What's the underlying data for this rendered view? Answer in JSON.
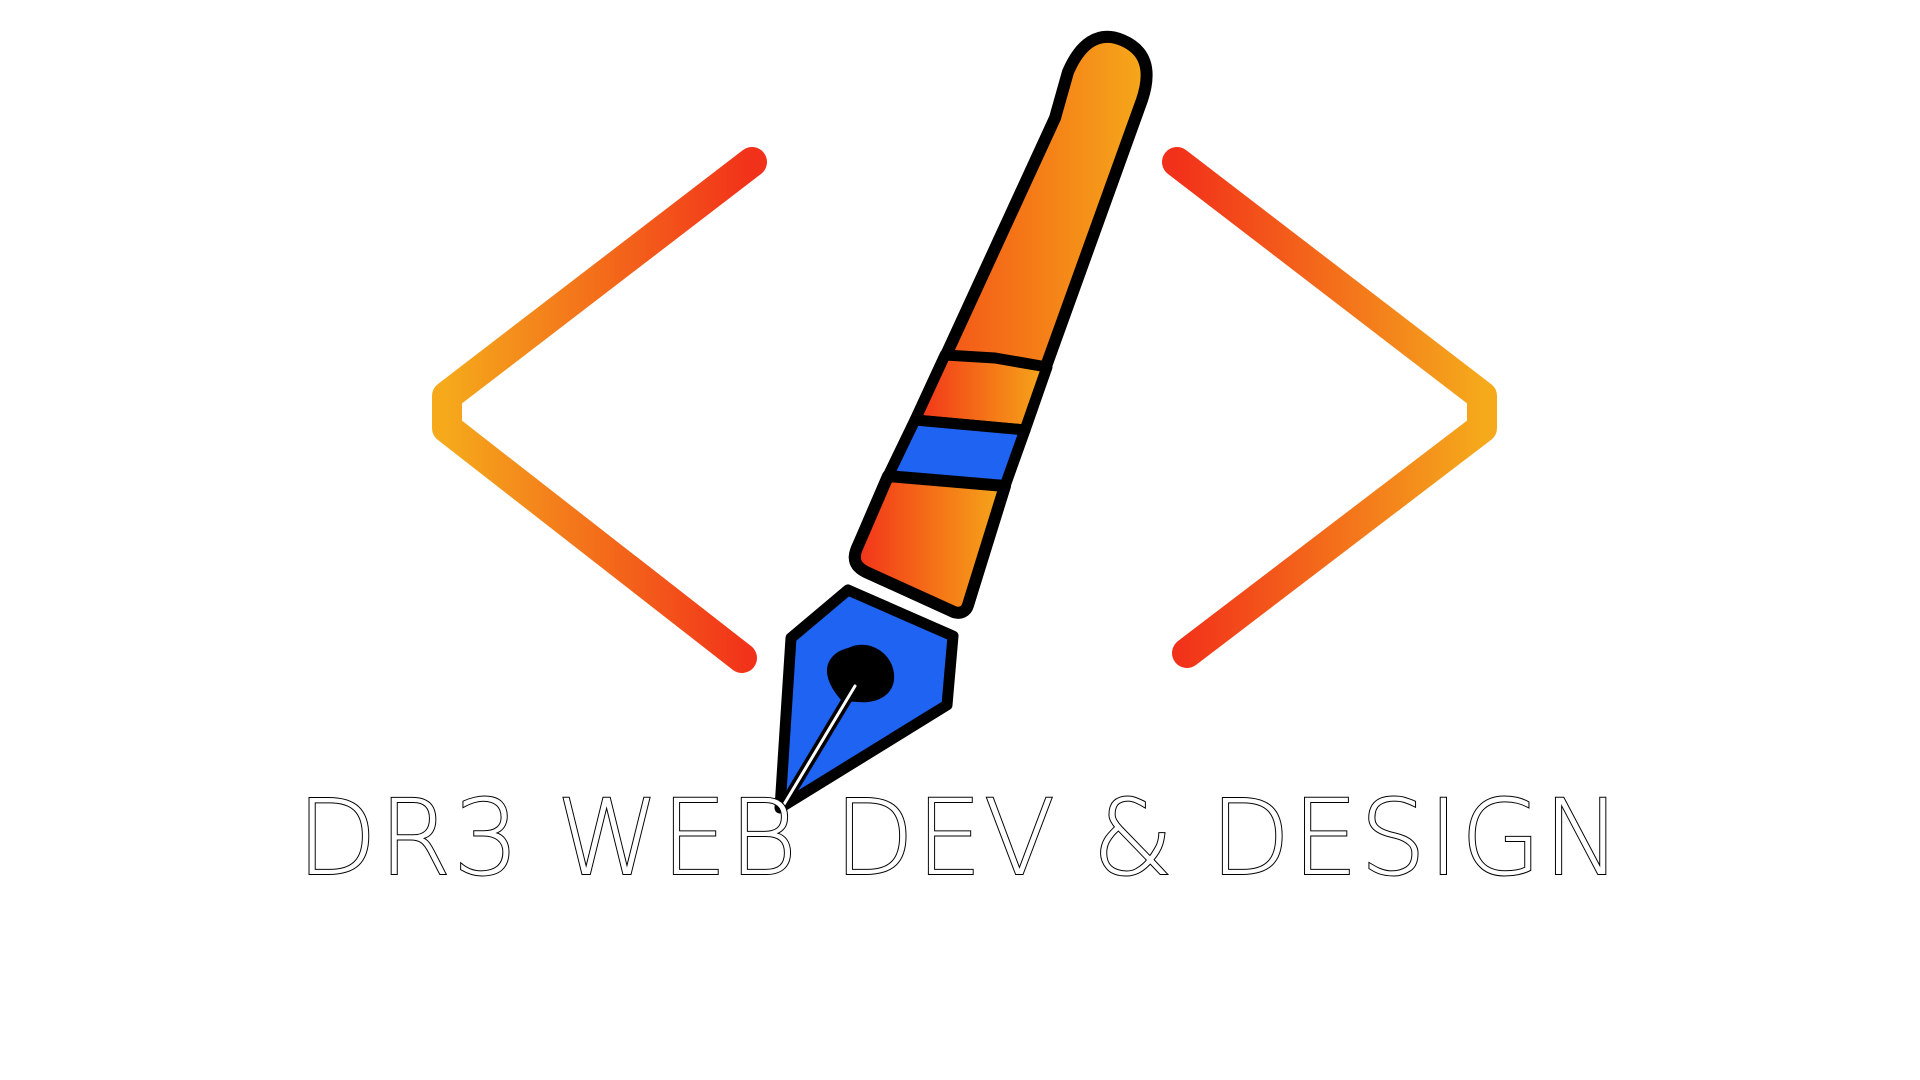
{
  "brand": {
    "name": "DR3 WEB DEV & DESIGN"
  },
  "logo": {
    "icons": [
      "left-angle-bracket-icon",
      "fountain-pen-icon",
      "right-angle-bracket-icon"
    ],
    "colors": {
      "gradient_red": "#f2311a",
      "gradient_orange": "#f57a17",
      "gradient_yellow": "#f5a91b",
      "pen_blue": "#1f63f2",
      "outline": "#000000",
      "background": "#ffffff"
    }
  }
}
